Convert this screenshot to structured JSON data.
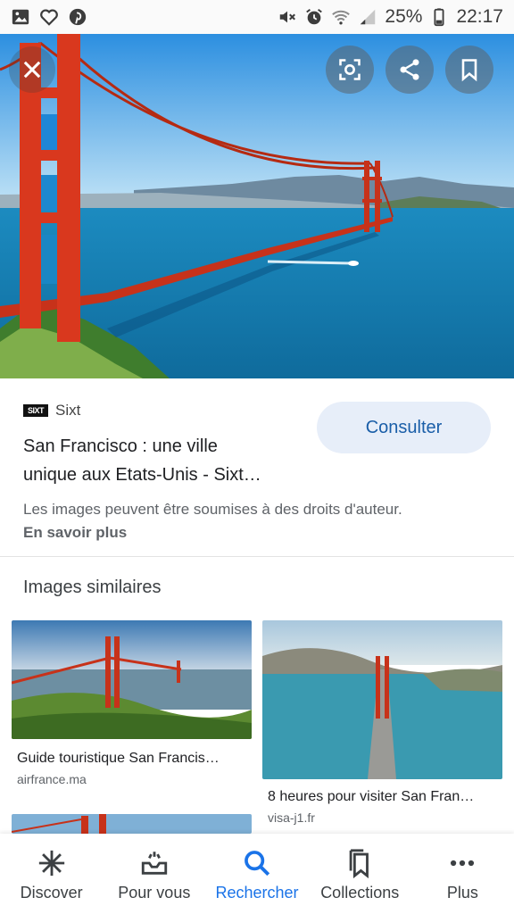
{
  "status_bar": {
    "battery": "25%",
    "time": "22:17",
    "icons": [
      "gallery-icon",
      "heart-icon",
      "pinterest-icon",
      "mute-icon",
      "alarm-icon",
      "wifi-icon",
      "signal-icon",
      "battery-icon"
    ]
  },
  "hero": {
    "actions": [
      "close-icon",
      "lens-icon",
      "share-icon",
      "bookmark-icon"
    ]
  },
  "result": {
    "source_logo": "SIXT",
    "source": "Sixt",
    "title_line1": "San Francisco : une ville",
    "title_line2": "unique aux Etats-Unis - Sixt…",
    "consult_label": "Consulter",
    "copyright": "Les images peuvent être soumises à des droits d'auteur.",
    "learn_more": "En savoir plus"
  },
  "similar": {
    "heading": "Images similaires",
    "items": [
      {
        "caption": "Guide touristique San Francis…",
        "site": "airfrance.ma"
      },
      {
        "caption": "8 heures pour visiter San Fran…",
        "site": "visa-j1.fr"
      }
    ]
  },
  "bottom_nav": {
    "items": [
      {
        "label": "Discover",
        "icon": "asterisk-icon"
      },
      {
        "label": "Pour vous",
        "icon": "inbox-icon"
      },
      {
        "label": "Rechercher",
        "icon": "search-icon"
      },
      {
        "label": "Collections",
        "icon": "collections-icon"
      },
      {
        "label": "Plus",
        "icon": "more-icon"
      }
    ],
    "active": "Rechercher"
  },
  "colors": {
    "accent": "#1a73e8",
    "consult_bg": "#e7eef9",
    "bridge": "#d9381e"
  }
}
